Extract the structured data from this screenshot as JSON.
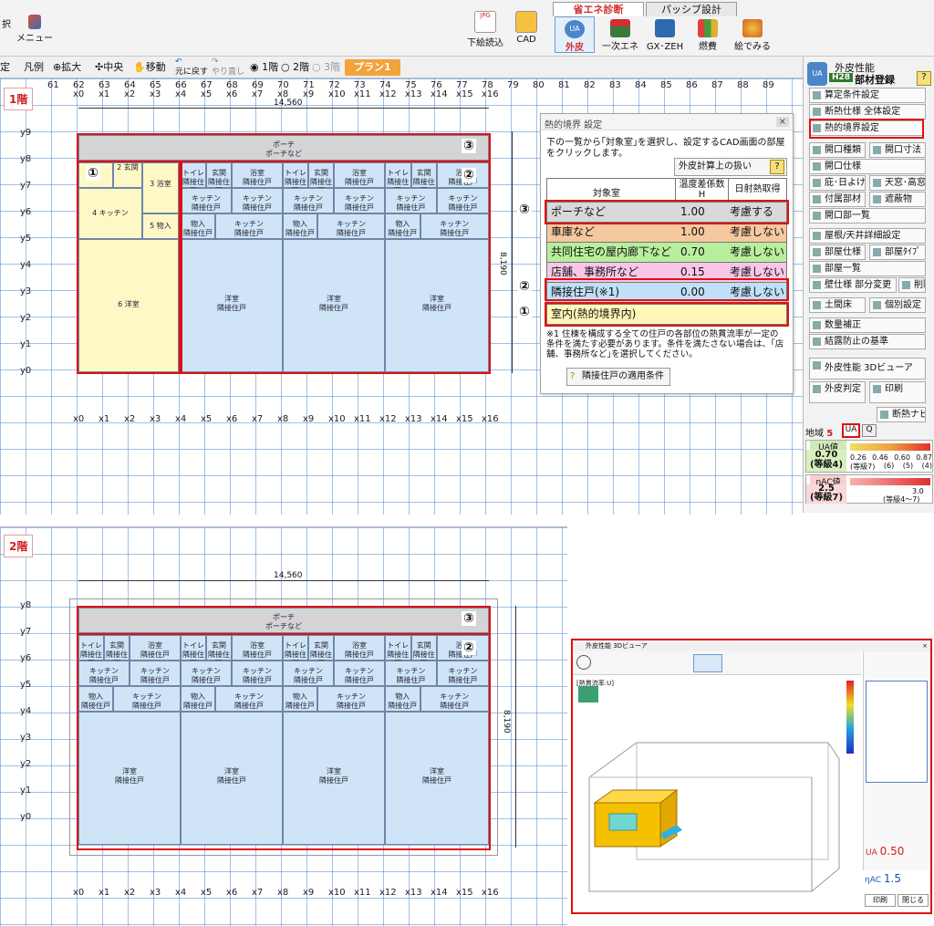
{
  "topbar": {
    "left_frag": "択",
    "menu_label": "メニュー",
    "btn_shitae": "下絵読込",
    "btn_cad": "CAD",
    "tab_shoene": "省エネ診断",
    "tab_passive": "パッシブ設計",
    "btn_gaihi": "外皮",
    "btn_ichiji": "一次エネ",
    "btn_gx": "GX･ZEH",
    "btn_nenpi": "燃費",
    "btn_edemiru": "絵でみる"
  },
  "bar2": {
    "frag": "定",
    "hanrei": "凡例",
    "kakudai": "拡大",
    "chuo": "中央",
    "idou": "移動",
    "modosu": "元に戻す",
    "yarinaoshi": "やり直し",
    "floor1": "1階",
    "floor2": "2階",
    "floor3": "3階",
    "plan": "プラン1"
  },
  "floor1": {
    "label": "1階",
    "top_axis": [
      "61",
      "62",
      "63",
      "64",
      "65",
      "66",
      "67",
      "68",
      "69",
      "70",
      "71",
      "72",
      "73",
      "74",
      "75",
      "76",
      "77",
      "78",
      "79",
      "80",
      "81",
      "82",
      "83",
      "84",
      "85",
      "86",
      "87",
      "88",
      "89"
    ],
    "x_axis": [
      "x0",
      "x1",
      "x2",
      "x3",
      "x4",
      "x5",
      "x6",
      "x7",
      "x8",
      "x9",
      "x10",
      "x11",
      "x12",
      "x13",
      "x14",
      "x15",
      "x16"
    ],
    "y_axis": [
      "y9",
      "y8",
      "y7",
      "y6",
      "y5",
      "y4",
      "y3",
      "y2",
      "y1",
      "y0"
    ],
    "width_dim": "14,560",
    "height_dim": "8,190",
    "porch": "ポーチ",
    "porch_sub": "ポーチなど",
    "genkan": "2 玄関",
    "yokushitsu": "3 浴室",
    "kitchen": "4 キッチン",
    "monoire": "5 物入",
    "yoshitsu": "6 洋室"
  },
  "rooms_common": {
    "yokushitsu": "浴室",
    "genkan": "玄関",
    "toilet": "トイレ",
    "kitchen": "キッチン",
    "monoire": "物入",
    "yoshitsu": "洋室",
    "rinsetsu": "隣接住戸"
  },
  "markers": [
    "①",
    "②",
    "③"
  ],
  "dialog": {
    "title": "熱的境界 設定",
    "instruction": "下の一覧から｢対象室｣を選択し、設定するCAD画面の部屋をクリックします。",
    "gaihi_btn": "外皮計算上の扱い",
    "col_room": "対象室",
    "col_coef": "温度差係数H",
    "col_solar": "日射熱取得",
    "rows": [
      {
        "name": "ポーチなど",
        "coef": "1.00",
        "solar": "考慮する",
        "color": "#d9d9d9"
      },
      {
        "name": "車庫など",
        "coef": "1.00",
        "solar": "考慮しない",
        "color": "#f6c8a0"
      },
      {
        "name": "共同住宅の屋内廊下など",
        "coef": "0.70",
        "solar": "考慮しない",
        "color": "#b8ef9c"
      },
      {
        "name": "店舗、事務所など",
        "coef": "0.15",
        "solar": "考慮しない",
        "color": "#f7c6e8"
      },
      {
        "name": "隣接住戸(※1)",
        "coef": "0.00",
        "solar": "考慮しない",
        "color": "#bfe0f6"
      }
    ],
    "indoor": "室内(熱的境界内)",
    "note": "※1 住棟を構成する全ての住戸の各部位の熱貫流率が一定の条件を満たす必要があります。条件を満たさない場合は、｢店舗、事務所など｣を選択してください。",
    "apply_btn": "隣接住戸の適用条件"
  },
  "rpanel": {
    "header": "外皮性能",
    "h28": "H28",
    "buhin": "部材登録",
    "items": [
      "算定条件設定",
      "断熱仕様 全体設定",
      "熱的境界設定",
      "開口種類",
      "開口寸法",
      "開口仕様",
      "庇･日よけ",
      "天窓･高窓",
      "付属部材",
      "遮蔽物",
      "開口部一覧",
      "屋根/天井詳細設定",
      "部屋仕様",
      "部屋ﾀｲﾌﾟ",
      "部屋一覧",
      "壁仕様 部分変更",
      "削除",
      "土間床",
      "個別設定",
      "数量補正",
      "結露防止の基準",
      "外皮性能 3Dビューア",
      "外皮判定",
      "印刷",
      "断熱ナビ"
    ],
    "chiiki_label": "地域",
    "chiiki_val": "5",
    "tab_ua": "UA",
    "tab_q": "Q",
    "ua_label": "UA値",
    "ua_val": "0.70",
    "ua_grade": "(等級4)",
    "ua_scale": [
      "0.26",
      "0.46",
      "0.60",
      "0.87"
    ],
    "ua_scale_g": [
      "(等級7)",
      "(6)",
      "(5)",
      "(4)"
    ],
    "eta_label": "ηAC値",
    "eta_val": "2.5",
    "eta_grade": "(等級7)",
    "eta_scale": "3.0",
    "eta_scale_g": "(等級4〜7)"
  },
  "floor2": {
    "label": "2階",
    "width_dim": "14,560",
    "height_dim": "8,190"
  },
  "viewer": {
    "title": "外皮性能 3Dビューア",
    "label": "[熱貫流率:U]",
    "ua_label": "UA",
    "ua_val": "0.50",
    "eta_label": "ηAC",
    "eta_val": "1.5",
    "print": "印刷",
    "close": "閉じる"
  },
  "colors": {
    "accent_red": "#e01010",
    "room_blue": "#cfe5f7",
    "room_yellow": "#fdf8c6",
    "porch_gray": "#d4d4d4"
  }
}
